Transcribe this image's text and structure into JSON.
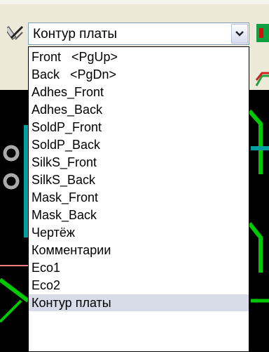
{
  "layer_selector": {
    "current_value": "Контур платы",
    "options": [
      "Front   <PgUp>",
      "Back   <PgDn>",
      "Adhes_Front",
      "Adhes_Back",
      "SoldP_Front",
      "SoldP_Back",
      "SilkS_Front",
      "SilkS_Back",
      "Mask_Front",
      "Mask_Back",
      "Чертёж",
      "Комментарии",
      "Eco1",
      "Eco2",
      "Контур платы"
    ],
    "selected_option": "Контур платы"
  },
  "icons": {
    "left_tool": "measure-tool-icon",
    "dropdown_arrow": "chevron-down-icon",
    "right_top": "green-layer-icon",
    "right_second": "route-icon"
  },
  "colors": {
    "toolbar_bg": "#ece9d8",
    "canvas_bg": "#000000",
    "track_green": "#00c800",
    "pad_teal": "#00a0a0",
    "selection_bg": "#d8dce8"
  }
}
